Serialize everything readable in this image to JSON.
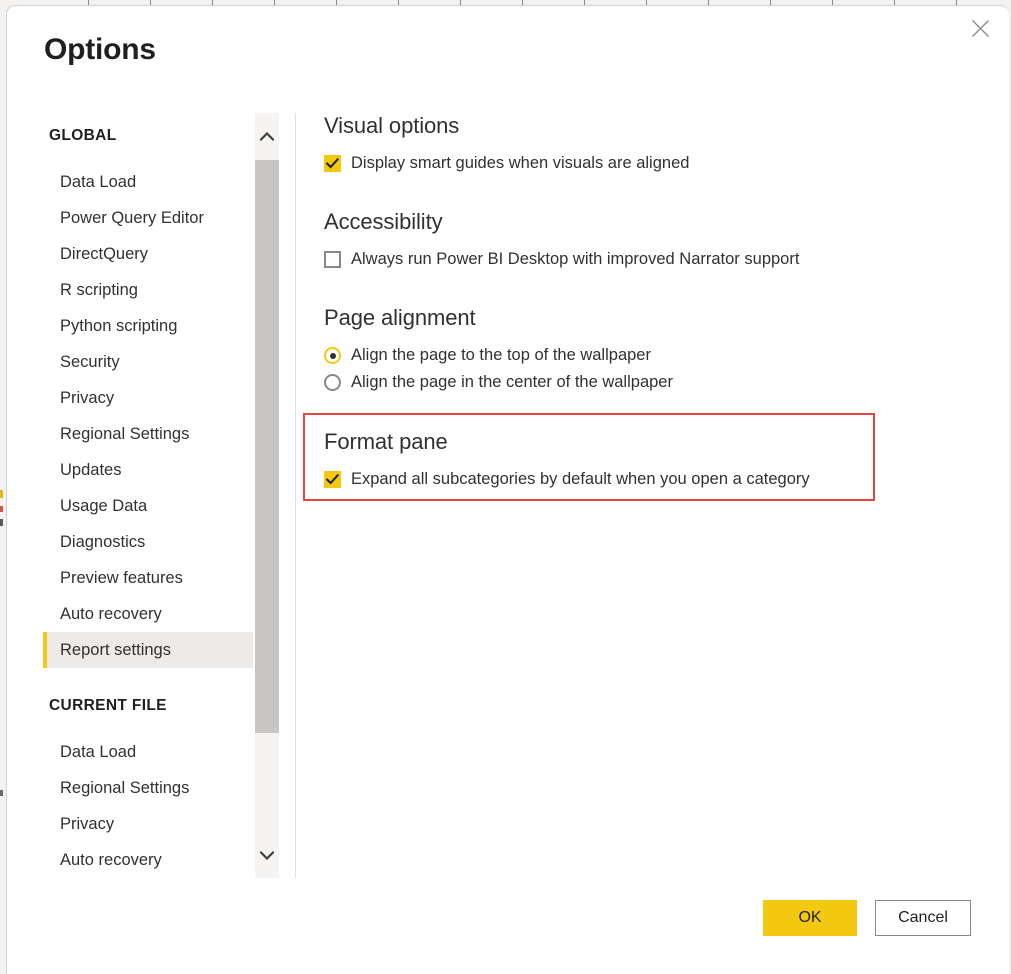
{
  "dialog": {
    "title": "Options",
    "close_icon": "close-icon"
  },
  "sidebar": {
    "groups": [
      {
        "title": "GLOBAL",
        "items": [
          {
            "label": "Data Load",
            "selected": false
          },
          {
            "label": "Power Query Editor",
            "selected": false
          },
          {
            "label": "DirectQuery",
            "selected": false
          },
          {
            "label": "R scripting",
            "selected": false
          },
          {
            "label": "Python scripting",
            "selected": false
          },
          {
            "label": "Security",
            "selected": false
          },
          {
            "label": "Privacy",
            "selected": false
          },
          {
            "label": "Regional Settings",
            "selected": false
          },
          {
            "label": "Updates",
            "selected": false
          },
          {
            "label": "Usage Data",
            "selected": false
          },
          {
            "label": "Diagnostics",
            "selected": false
          },
          {
            "label": "Preview features",
            "selected": false
          },
          {
            "label": "Auto recovery",
            "selected": false
          },
          {
            "label": "Report settings",
            "selected": true
          }
        ]
      },
      {
        "title": "CURRENT FILE",
        "items": [
          {
            "label": "Data Load",
            "selected": false
          },
          {
            "label": "Regional Settings",
            "selected": false
          },
          {
            "label": "Privacy",
            "selected": false
          },
          {
            "label": "Auto recovery",
            "selected": false
          }
        ]
      }
    ],
    "scrollbar": {
      "up_icon": "chevron-up-icon",
      "down_icon": "chevron-down-icon"
    }
  },
  "content": {
    "sections": [
      {
        "heading": "Visual options",
        "options": [
          {
            "type": "checkbox",
            "state": "checked",
            "label": "Display smart guides when visuals are aligned"
          }
        ]
      },
      {
        "heading": "Accessibility",
        "options": [
          {
            "type": "checkbox",
            "state": "unchecked",
            "label": "Always run Power BI Desktop with improved Narrator support"
          }
        ]
      },
      {
        "heading": "Page alignment",
        "options": [
          {
            "type": "radio",
            "state": "selected",
            "label": "Align the page to the top of the wallpaper"
          },
          {
            "type": "radio",
            "state": "unselected",
            "label": "Align the page in the center of the wallpaper"
          }
        ]
      },
      {
        "heading": "Format pane",
        "highlighted": true,
        "options": [
          {
            "type": "checkbox",
            "state": "checked",
            "label": "Expand all subcategories by default when you open a category"
          }
        ]
      }
    ]
  },
  "footer": {
    "ok_label": "OK",
    "cancel_label": "Cancel"
  },
  "colors": {
    "accent_gold": "#f2c811",
    "highlight_red": "#e8453c",
    "selected_item_bg": "#edebe9",
    "text_primary": "#323130",
    "scrollbar_thumb": "#c8c6c4"
  }
}
